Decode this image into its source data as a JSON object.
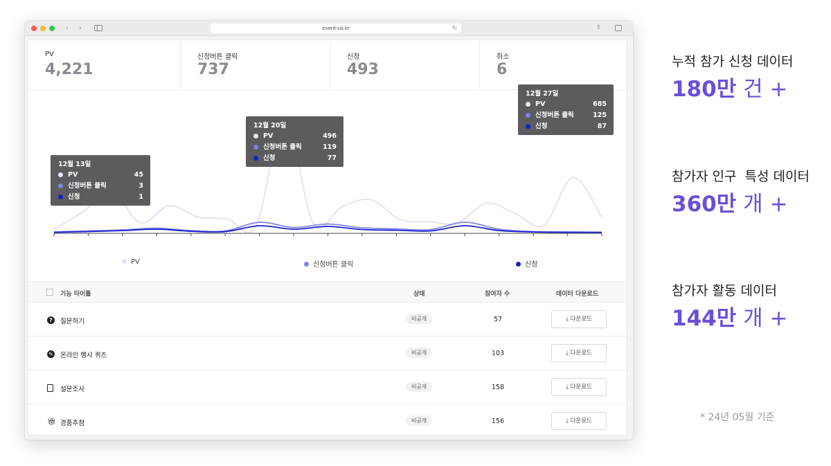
{
  "browser": {
    "url": "event-us.kr"
  },
  "stats": [
    {
      "label": "PV",
      "value": "4,221"
    },
    {
      "label": "신청버튼 클릭",
      "value": "737"
    },
    {
      "label": "신청",
      "value": "493"
    },
    {
      "label": "취소",
      "value": "6"
    }
  ],
  "colors": {
    "pv": "#e3e3f5",
    "click": "#8183e6",
    "signup": "#1a1fc8",
    "accent": "#6b4fd8"
  },
  "chart_data": {
    "type": "line",
    "series": [
      {
        "name": "PV",
        "values": [
          10,
          60,
          120,
          28,
          78,
          45,
          40,
          18,
          330,
          25,
          75,
          95,
          38,
          32,
          28,
          85,
          55,
          22,
          160,
          45
        ]
      },
      {
        "name": "신청버튼 클릭",
        "values": [
          2,
          5,
          8,
          13,
          6,
          5,
          30,
          15,
          25,
          14,
          11,
          9,
          30,
          10,
          3,
          2,
          1
        ]
      },
      {
        "name": "신청",
        "values": [
          1,
          3,
          6,
          10,
          4,
          3,
          20,
          10,
          18,
          9,
          7,
          5,
          20,
          6,
          2,
          1,
          1
        ]
      }
    ],
    "tooltips": [
      {
        "date": "12월 13일",
        "rows": [
          {
            "name": "PV",
            "value": "45"
          },
          {
            "name": "신청버튼 클릭",
            "value": "3"
          },
          {
            "name": "신청",
            "value": "1"
          }
        ]
      },
      {
        "date": "12월 20일",
        "rows": [
          {
            "name": "PV",
            "value": "496"
          },
          {
            "name": "신청버튼 클릭",
            "value": "119"
          },
          {
            "name": "신청",
            "value": "77"
          }
        ]
      },
      {
        "date": "12월 27일",
        "rows": [
          {
            "name": "PV",
            "value": "685"
          },
          {
            "name": "신청버튼 클릭",
            "value": "125"
          },
          {
            "name": "신청",
            "value": "87"
          }
        ]
      }
    ],
    "legend": [
      "PV",
      "신청버튼 클릭",
      "신청"
    ],
    "grid": false,
    "legend_position": "bottom"
  },
  "table": {
    "headers": {
      "title": "기능 타이틀",
      "status": "상태",
      "participants": "참여자 수",
      "download": "데이터 다운로드"
    },
    "rows": [
      {
        "icon": "question-circle-icon",
        "name": "질문하기",
        "status": "비공개",
        "count": "57",
        "download": "다운로드"
      },
      {
        "icon": "quiz-icon",
        "name": "온라인 행사 퀴즈",
        "status": "비공개",
        "count": "103",
        "download": "다운로드"
      },
      {
        "icon": "clipboard-icon",
        "name": "설문조사",
        "status": "비공개",
        "count": "158",
        "download": "다운로드"
      },
      {
        "icon": "gift-icon",
        "name": "경품추첨",
        "status": "비공개",
        "count": "156",
        "download": "다운로드"
      }
    ]
  },
  "info": [
    {
      "title": "누적 참가 신청 데이터",
      "number": "180만",
      "unit": "건 +"
    },
    {
      "title": "참가자 인구  특성 데이터",
      "number": "360만",
      "unit": "개 +"
    },
    {
      "title": "참가자 활동 데이터",
      "number": "144만",
      "unit": "개 +"
    }
  ],
  "footnote": "* 24년 05월 기준"
}
